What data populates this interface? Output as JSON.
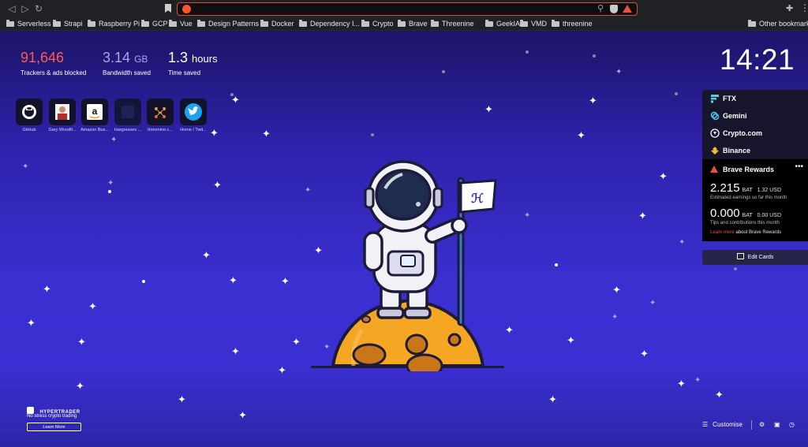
{
  "browser": {
    "nav": {
      "back": "◁",
      "forward": "▷",
      "reload": "↻"
    },
    "omnibox": {
      "value": "",
      "zoom_icon": "zoom-icon"
    },
    "extensions_icon": "puzzle-icon",
    "bookmarks": [
      "Serverless",
      "Strapi",
      "Raspberry Pi",
      "GCP",
      "Vue",
      "Design Patterns",
      "Docker",
      "Dependency I...",
      "Crypto",
      "Brave",
      "Threenine",
      "GeekIAm",
      "VMD",
      "threenine"
    ],
    "other_bookmarks": "Other bookmarks"
  },
  "stats": {
    "trackers": {
      "value": "91,646",
      "label": "Trackers & ads blocked"
    },
    "bandwidth": {
      "value": "3.14",
      "unit": "GB",
      "label": "Bandwidth saved"
    },
    "time": {
      "value": "1.3",
      "unit": "hours",
      "label": "Time saved"
    }
  },
  "top_sites": [
    {
      "label": "GitHub",
      "icon": "github-icon"
    },
    {
      "label": "Gary Woodfi...",
      "icon": "profile-photo"
    },
    {
      "label": "Amazon Bus...",
      "icon": "amazon-icon"
    },
    {
      "label": "Hargreaves ...",
      "icon": "hargreaves-icon"
    },
    {
      "label": "threenine.c...",
      "icon": "threenine-icon"
    },
    {
      "label": "Home / Twit...",
      "icon": "twitter-icon"
    }
  ],
  "clock": "14:21",
  "cards": {
    "exchanges": [
      "FTX",
      "Gemini",
      "Crypto.com",
      "Binance"
    ],
    "rewards": {
      "title": "Brave Rewards",
      "earnings_value": "2.215",
      "earnings_unit": "BAT",
      "earnings_fiat": "1.32 USD",
      "earnings_caption": "Estimated earnings so far this month",
      "tips_value": "0.000",
      "tips_unit": "BAT",
      "tips_fiat": "0.00 USD",
      "tips_caption": "Tips and contributions this month",
      "learn_more": "Learn more",
      "learn_more_suffix": " about Brave Rewards"
    },
    "edit_label": "Edit Cards"
  },
  "promo": {
    "brand": "HYPERTRADER",
    "tagline": "No stress crypto trading",
    "button": "Learn More"
  },
  "bottom": {
    "customise": "Customise"
  },
  "colors": {
    "accent": "#e8513a",
    "trackers": "#ff5b4a",
    "bandwidth": "#a9a6e6"
  }
}
